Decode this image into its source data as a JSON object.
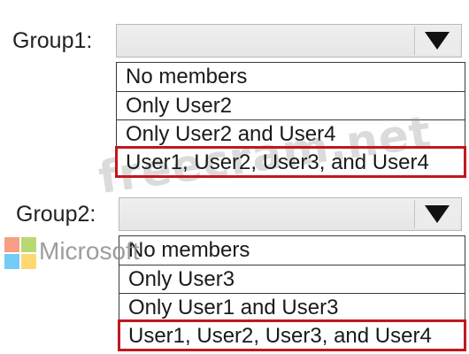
{
  "groups": [
    {
      "label": "Group1:",
      "selected_value": "",
      "options": [
        "No members",
        "Only User2",
        "Only User2 and User4",
        "User1, User2, User3, and User4"
      ],
      "highlighted_index": 3
    },
    {
      "label": "Group2:",
      "selected_value": "",
      "options": [
        "No members",
        "Only User3",
        "Only User1 and User3",
        "User1, User2, User3, and User4"
      ],
      "highlighted_index": 3
    }
  ],
  "watermark": {
    "text": "freecram.net",
    "brand": "Microsoft",
    "logo_colors": [
      "#f25022",
      "#7fba00",
      "#00a4ef",
      "#ffb900"
    ]
  },
  "colors": {
    "highlight": "#c0181f",
    "dropdown_bg": "#ececec"
  }
}
